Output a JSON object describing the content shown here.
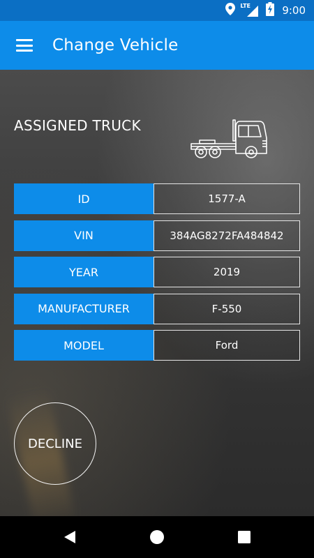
{
  "status_bar": {
    "network_label": "LTE",
    "time": "9:00",
    "icons": [
      "location-icon",
      "signal-icon",
      "battery-charging-icon"
    ]
  },
  "app_bar": {
    "title": "Change Vehicle",
    "menu_icon": "hamburger-menu-icon"
  },
  "truck_section": {
    "title": "ASSIGNED TRUCK",
    "icon": "semi-truck-icon"
  },
  "fields": [
    {
      "label": "ID",
      "value": "1577-A"
    },
    {
      "label": "VIN",
      "value": "384AG8272FA484842"
    },
    {
      "label": "YEAR",
      "value": "2019"
    },
    {
      "label": "MANUFACTURER",
      "value": "F-550"
    },
    {
      "label": "MODEL",
      "value": "Ford"
    }
  ],
  "actions": {
    "decline_label": "DECLINE"
  },
  "nav_bar": {
    "buttons": [
      "back-icon",
      "home-icon",
      "recents-icon"
    ]
  },
  "colors": {
    "status_bar": "#0b6fc4",
    "app_bar": "#0d8ce9",
    "label_bg": "#0d8ce9",
    "text": "#ffffff"
  }
}
